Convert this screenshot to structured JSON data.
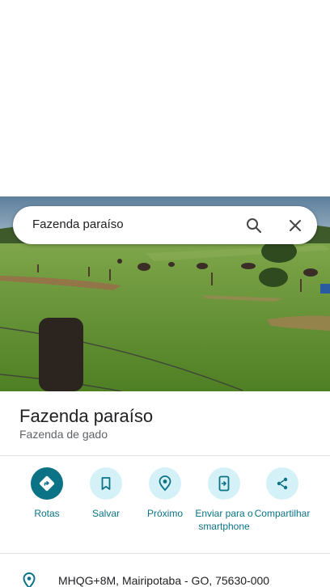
{
  "search": {
    "query": "Fazenda paraíso",
    "search_icon": "search-icon",
    "close_icon": "close-icon"
  },
  "photo": {
    "subject": "place-photo",
    "sky_color": "#6f8fa8",
    "grass_color": "#5f8f2e"
  },
  "place": {
    "name": "Fazenda paraíso",
    "category": "Fazenda de gado"
  },
  "actions": [
    {
      "label": "Rotas",
      "icon": "directions-icon"
    },
    {
      "label": "Salvar",
      "icon": "bookmark-icon"
    },
    {
      "label": "Próximo",
      "icon": "nearby-icon"
    },
    {
      "label": "Enviar para o smartphone",
      "icon": "send-to-phone-icon"
    },
    {
      "label": "Compartilhar",
      "icon": "share-icon"
    }
  ],
  "address": {
    "icon": "location-pin-icon",
    "text": "MHQG+8M, Mairipotaba - GO, 75630-000"
  },
  "colors": {
    "accent": "#0b7385",
    "accent_light": "#d4f1f8",
    "text_primary": "#202124",
    "text_secondary": "#5f6368"
  }
}
